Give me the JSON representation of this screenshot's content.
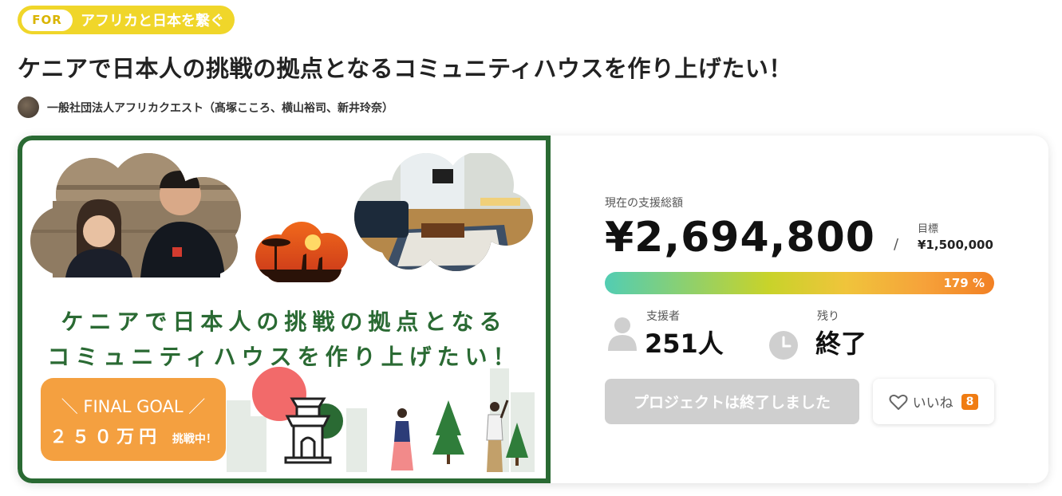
{
  "tag": {
    "prefix": "FOR",
    "label": "アフリカと日本を繋ぐ"
  },
  "project": {
    "title": "ケニアで日本人の挑戦の拠点となるコミュニティハウスを作り上げたい！",
    "owner": "一般社団法人アフリカクエスト（髙塚こころ、横山裕司、新井玲奈）"
  },
  "visual": {
    "title_line1": "ケニアで日本人の挑戦の拠点となる",
    "title_line2": "コミュニティハウスを作り上げたい！",
    "goal_line1": "＼ FINAL GOAL ／",
    "goal_amount": "２５０万円",
    "goal_suffix": "挑戦中！"
  },
  "stats": {
    "total_label": "現在の支援総額",
    "total_amount": "¥2,694,800",
    "separator": "/",
    "goal_label": "目標",
    "goal_amount": "¥1,500,000",
    "progress_text": "179 %",
    "progress_fraction": 1.79,
    "supporters_label": "支援者",
    "supporters_value": "251人",
    "remaining_label": "残り",
    "remaining_value": "終了"
  },
  "actions": {
    "ended_label": "プロジェクトは終了しました",
    "like_label": "いいね",
    "like_count": "8"
  },
  "colors": {
    "tag_yellow": "#f0d62a",
    "visual_green": "#2a6a33",
    "goal_orange": "#f4a040",
    "like_badge": "#f07c12",
    "ended_gray": "#cfcfcf"
  },
  "icons": {
    "supporters": "person-icon",
    "remaining": "clock-icon",
    "like": "heart-icon"
  }
}
